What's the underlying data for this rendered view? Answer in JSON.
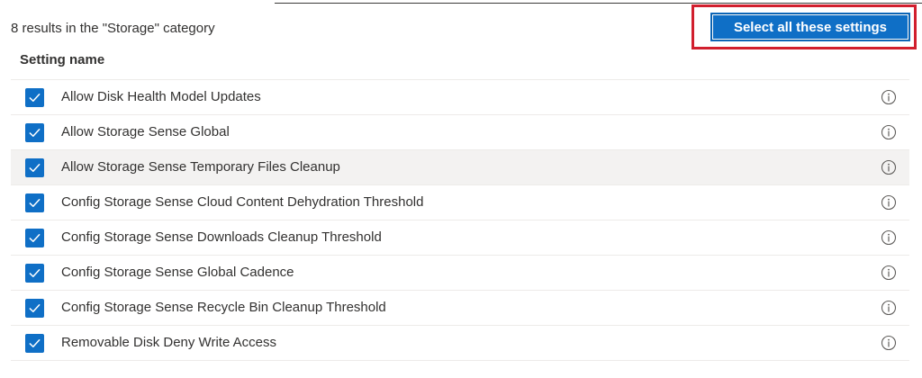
{
  "header": {
    "results_summary": "8 results in the \"Storage\" category",
    "select_all_label": "Select all these settings"
  },
  "table": {
    "column_header": "Setting name",
    "rows": [
      {
        "label": "Allow Disk Health Model Updates",
        "checked": true
      },
      {
        "label": "Allow Storage Sense Global",
        "checked": true
      },
      {
        "label": "Allow Storage Sense Temporary Files Cleanup",
        "checked": true,
        "hovered": true
      },
      {
        "label": "Config Storage Sense Cloud Content Dehydration Threshold",
        "checked": true
      },
      {
        "label": "Config Storage Sense Downloads Cleanup Threshold",
        "checked": true
      },
      {
        "label": "Config Storage Sense Global Cadence",
        "checked": true
      },
      {
        "label": "Config Storage Sense Recycle Bin Cleanup Threshold",
        "checked": true
      },
      {
        "label": "Removable Disk Deny Write Access",
        "checked": true
      }
    ]
  },
  "icons": {
    "row_checkbox": "checkmark-icon",
    "row_info": "info-icon"
  },
  "colors": {
    "accent": "#0f6fc6",
    "highlight_border": "#d11f2e",
    "hover_row": "#f3f2f1",
    "text": "#323130",
    "divider": "#edebe9"
  }
}
